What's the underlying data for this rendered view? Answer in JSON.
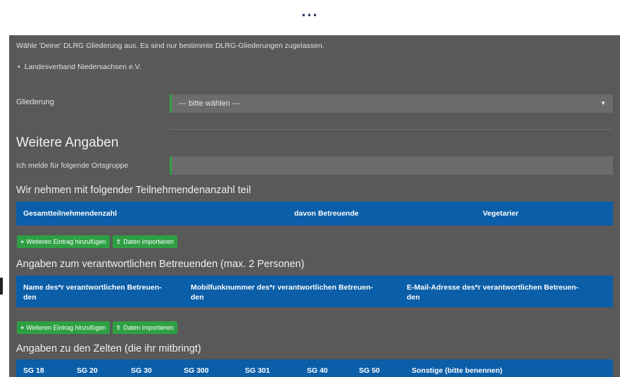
{
  "top_ellipsis": "...",
  "intro_text": "Wähle 'Deine' DLRG Gliederung aus. Es sind nur bestimmte DLRG-Gliederungen zugelassen.",
  "allowed_list": [
    "Landesverband Niedersachsen e.V."
  ],
  "gliederung": {
    "label": "Gliederung",
    "placeholder": "--- bitte wählen ---"
  },
  "weitere": {
    "title": "Weitere Angaben",
    "ortsgruppe_label": "Ich melde für folgende Ortsgruppe",
    "ortsgruppe_value": ""
  },
  "teilnehmer": {
    "title": "Wir nehmen mit folgender Teilnehmendenanzahl teil",
    "headers": [
      "Gesamtteilnehmendenzahl",
      "davon Betreuende",
      "Vegetarier"
    ]
  },
  "buttons": {
    "add": "Weiteren Eintrag hinzufügen",
    "import": "Daten importieren"
  },
  "betreuende": {
    "title": "Angaben zum verantwortlichen Betreuenden (max. 2 Personen)",
    "headers": [
      [
        "Name des*r verantwortlichen Betreuen-",
        "den"
      ],
      [
        "Mobilfunknummer des*r verantwortlichen Betreuen-",
        "den"
      ],
      [
        "E-Mail-Adresse des*r verantwortlichen Betreuen-",
        "den"
      ]
    ]
  },
  "zelte": {
    "title": "Angaben zu den Zelten (die ihr mitbringt)",
    "headers": [
      "SG 18",
      "SG 20",
      "SG 30",
      "SG 300",
      "SG 301",
      "SG 40",
      "SG 50",
      "Sonstige (bitte benennen)"
    ]
  },
  "colors": {
    "panel": "#595959",
    "header_blue": "#0b5ea8",
    "button_green": "#2ea043"
  }
}
